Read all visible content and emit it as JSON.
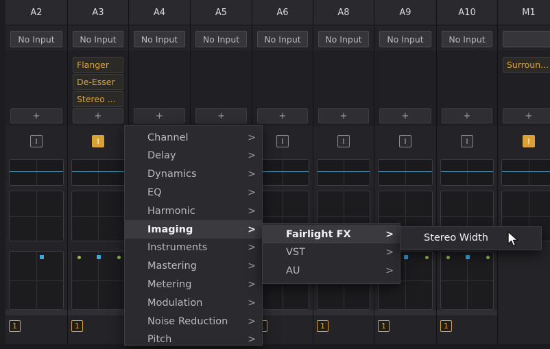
{
  "channels": [
    {
      "name": "A2",
      "input": "No Input",
      "fx": [],
      "insert_on": false
    },
    {
      "name": "A3",
      "input": "No Input",
      "fx": [
        "Flanger",
        "De-Esser",
        "Stereo ..."
      ],
      "insert_on": true
    },
    {
      "name": "A4",
      "input": "No Input",
      "fx": [],
      "insert_on": false
    },
    {
      "name": "A5",
      "input": "No Input",
      "fx": [],
      "insert_on": false
    },
    {
      "name": "A6",
      "input": "No Input",
      "fx": [],
      "insert_on": false
    },
    {
      "name": "A8",
      "input": "No Input",
      "fx": [],
      "insert_on": false
    },
    {
      "name": "A9",
      "input": "No Input",
      "fx": [],
      "insert_on": false
    },
    {
      "name": "A10",
      "input": "No Input",
      "fx": [],
      "insert_on": false
    },
    {
      "name": "M1",
      "input": "",
      "fx": [
        "Surroun..."
      ],
      "insert_on": true
    }
  ],
  "add_label": "+",
  "insert_label": "I",
  "track_number": "1",
  "menu": {
    "items": [
      "Channel",
      "Delay",
      "Dynamics",
      "EQ",
      "Harmonic",
      "Imaging",
      "Instruments",
      "Mastering",
      "Metering",
      "Modulation",
      "Noise Reduction",
      "Pitch"
    ],
    "highlighted": "Imaging",
    "chevron": ">"
  },
  "submenu": {
    "items": [
      "Fairlight FX",
      "VST",
      "AU"
    ],
    "highlighted": "Fairlight FX"
  },
  "submenu2": {
    "items": [
      "Stereo Width"
    ],
    "highlighted": "Stereo Width"
  },
  "colors": {
    "accent": "#d9a136",
    "eq_line": "#5fb4d6",
    "pan_blue": "#3aa7e0",
    "pan_green": "#8fbf4a"
  },
  "icons": {
    "cursor": "mouse-pointer-icon",
    "chevron": "chevron-right-icon"
  }
}
